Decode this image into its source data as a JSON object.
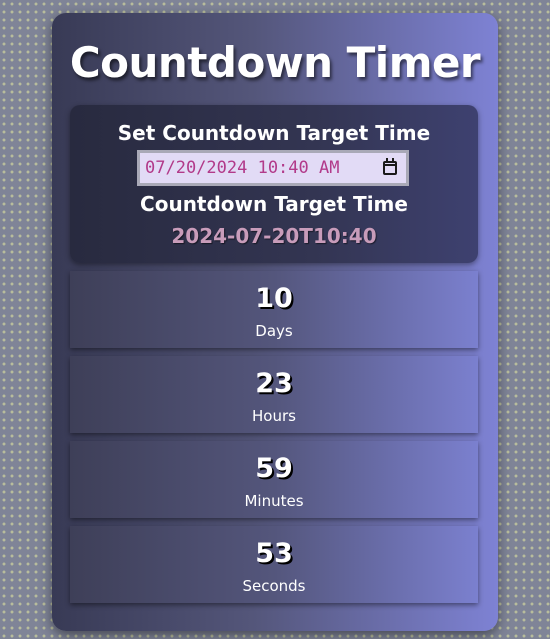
{
  "title": "Countdown Timer",
  "set_target": {
    "label": "Set Countdown Target Time",
    "input_value": "07/20/2024 10:40 AM",
    "calendar_icon": "calendar-icon"
  },
  "target": {
    "label": "Countdown Target Time",
    "value": "2024-07-20T10:40"
  },
  "countdown": [
    {
      "value": "10",
      "label": "Days"
    },
    {
      "value": "23",
      "label": "Hours"
    },
    {
      "value": "59",
      "label": "Minutes"
    },
    {
      "value": "53",
      "label": "Seconds"
    }
  ]
}
